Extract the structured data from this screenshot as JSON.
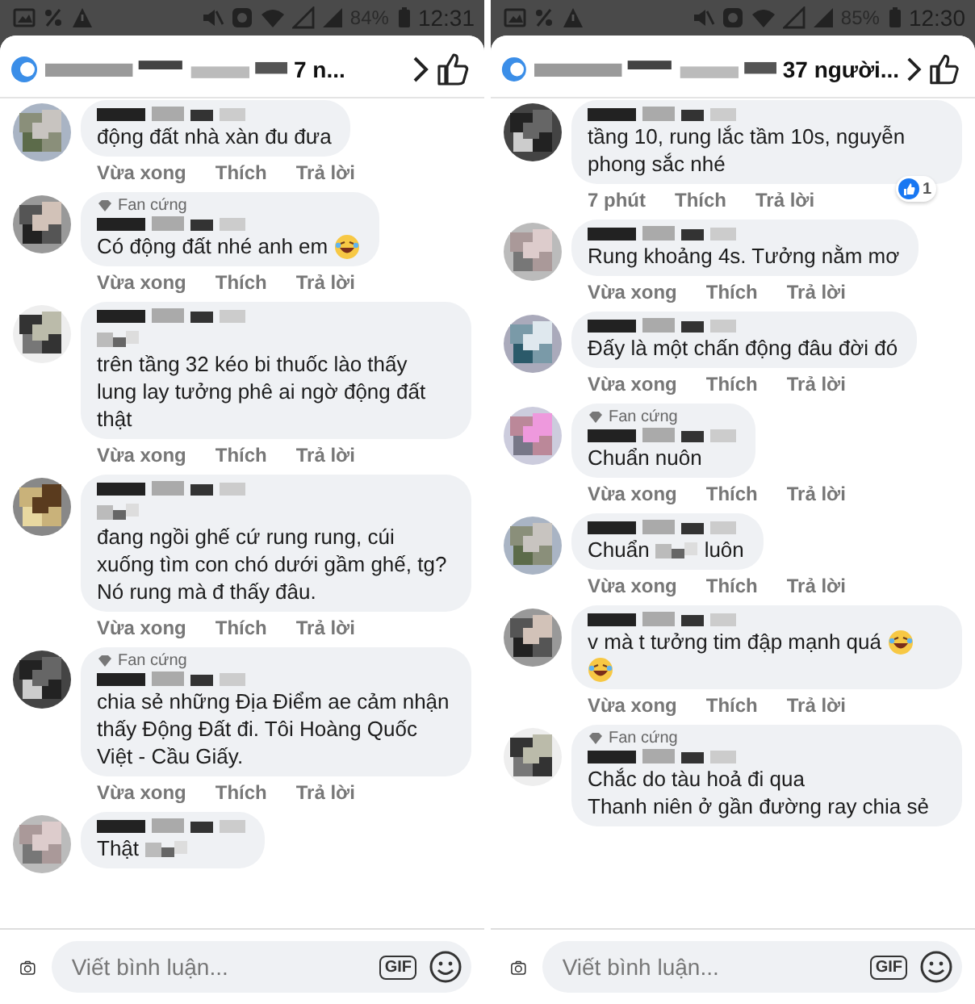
{
  "panels": [
    {
      "status_bar": {
        "battery": "84%",
        "time": "12:31"
      },
      "header": {
        "title": "7 n..."
      },
      "comments": [
        {
          "name_hidden": true,
          "segments": [
            {
              "kind": "text",
              "text": "động đất nhà xàn đu đưa"
            }
          ],
          "meta": {
            "time": "Vừa xong",
            "like": "Thích",
            "reply": "Trả lời"
          }
        },
        {
          "badge": "Fan cứng",
          "name_hidden": true,
          "segments": [
            {
              "kind": "text",
              "text": "Có động đất nhé anh em"
            },
            {
              "kind": "emoji"
            }
          ],
          "meta": {
            "time": "Vừa xong",
            "like": "Thích",
            "reply": "Trả lời"
          }
        },
        {
          "name_hidden": true,
          "segments": [
            {
              "kind": "censor"
            },
            {
              "kind": "text",
              "text": "trên tầng 32 kéo bi thuốc lào thấy  lung lay tưởng phê ai ngờ động đất thật"
            }
          ],
          "meta": {
            "time": "Vừa xong",
            "like": "Thích",
            "reply": "Trả lời"
          }
        },
        {
          "name_hidden": true,
          "segments": [
            {
              "kind": "censor"
            },
            {
              "kind": "text",
              "text": "đang ngồi ghế cứ rung rung, cúi xuống tìm con chó dưới gầm ghế, tg? Nó rung mà đ thấy đâu."
            }
          ],
          "meta": {
            "time": "Vừa xong",
            "like": "Thích",
            "reply": "Trả lời"
          }
        },
        {
          "badge": "Fan cứng",
          "name_hidden": true,
          "segments": [
            {
              "kind": "text",
              "text": "chia sẻ những Địa Điểm ae cảm nhận thấy Động Đất đi. Tôi Hoàng Quốc Việt - Cầu Giấy."
            }
          ],
          "meta": {
            "time": "Vừa xong",
            "like": "Thích",
            "reply": "Trả lời"
          }
        },
        {
          "name_hidden": true,
          "segments": [
            {
              "kind": "text",
              "text": "Thật"
            },
            {
              "kind": "censor"
            }
          ]
        }
      ],
      "composer": {
        "placeholder": "Viết bình luận...",
        "gif": "GIF"
      }
    },
    {
      "status_bar": {
        "battery": "85%",
        "time": "12:30"
      },
      "header": {
        "title": "37 người..."
      },
      "comments": [
        {
          "name_hidden": true,
          "segments": [
            {
              "kind": "text",
              "text": "tầng 10, rung lắc tầm 10s, nguyễn phong sắc nhé"
            }
          ],
          "meta": {
            "time": "7 phút",
            "like": "Thích",
            "reply": "Trả lời"
          },
          "reaction": {
            "count": "1"
          }
        },
        {
          "name_hidden": true,
          "segments": [
            {
              "kind": "text",
              "text": "Rung khoảng 4s. Tưởng nằm mơ"
            }
          ],
          "meta": {
            "time": "Vừa xong",
            "like": "Thích",
            "reply": "Trả lời"
          }
        },
        {
          "name_hidden": true,
          "segments": [
            {
              "kind": "text",
              "text": "Đấy là một chấn động đâu đời đó"
            }
          ],
          "meta": {
            "time": "Vừa xong",
            "like": "Thích",
            "reply": "Trả lời"
          }
        },
        {
          "badge": "Fan cứng",
          "name_hidden": true,
          "segments": [
            {
              "kind": "text",
              "text": "Chuẩn nuôn"
            }
          ],
          "meta": {
            "time": "Vừa xong",
            "like": "Thích",
            "reply": "Trả lời"
          }
        },
        {
          "name_hidden": true,
          "segments": [
            {
              "kind": "text",
              "text": "Chuẩn"
            },
            {
              "kind": "censor"
            },
            {
              "kind": "text",
              "text": "luôn"
            }
          ],
          "meta": {
            "time": "Vừa xong",
            "like": "Thích",
            "reply": "Trả lời"
          }
        },
        {
          "name_hidden": true,
          "segments": [
            {
              "kind": "text",
              "text": "v mà t tưởng tim đập mạnh quá"
            },
            {
              "kind": "emoji"
            },
            {
              "kind": "emoji"
            }
          ],
          "meta": {
            "time": "Vừa xong",
            "like": "Thích",
            "reply": "Trả lời"
          }
        },
        {
          "badge": "Fan cứng",
          "name_hidden": true,
          "segments": [
            {
              "kind": "text",
              "text": "Chắc do tàu hoả đi qua"
            },
            {
              "kind": "break"
            },
            {
              "kind": "text",
              "text": "Thanh niên ở gần đường ray chia sẻ"
            }
          ]
        }
      ],
      "composer": {
        "placeholder": "Viết bình luận...",
        "gif": "GIF"
      }
    }
  ]
}
